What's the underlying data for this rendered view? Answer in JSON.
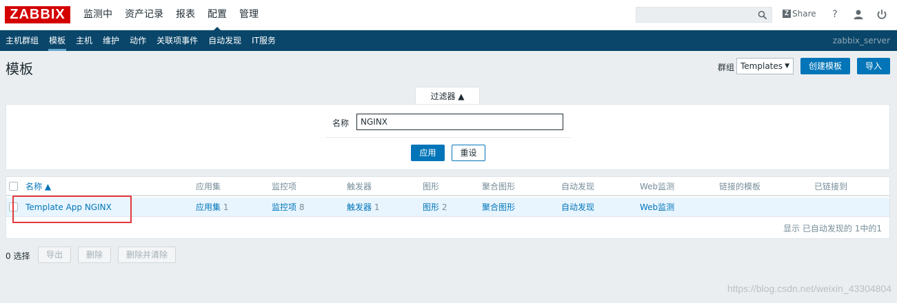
{
  "logo": "ZABBIX",
  "top_nav": [
    "监测中",
    "资产记录",
    "报表",
    "配置",
    "管理"
  ],
  "search": {
    "value": ""
  },
  "share_label": "Share",
  "help_icon": "?",
  "sub_nav": [
    "主机群组",
    "模板",
    "主机",
    "维护",
    "动作",
    "关联项事件",
    "自动发现",
    "IT服务"
  ],
  "server_name": "zabbix_server",
  "page_title": "模板",
  "group_filter": {
    "label": "群组",
    "value": "Templates"
  },
  "buttons": {
    "create": "创建模板",
    "import": "导入"
  },
  "filter": {
    "tab_label": "过滤器 ▲",
    "name_label": "名称",
    "name_value": "NGINX",
    "apply": "应用",
    "reset": "重设"
  },
  "table": {
    "headers": [
      "名称 ▲",
      "应用集",
      "监控项",
      "触发器",
      "图形",
      "聚合图形",
      "自动发现",
      "Web监测",
      "链接的模板",
      "已链接到"
    ],
    "rows": [
      {
        "name": "Template App NGINX",
        "applications": "应用集",
        "applications_count": "1",
        "items": "监控项",
        "items_count": "8",
        "triggers": "触发器",
        "triggers_count": "1",
        "graphs": "图形",
        "graphs_count": "2",
        "screens": "聚合图形",
        "discovery": "自动发现",
        "web": "Web监测"
      }
    ],
    "footer": "显示 已自动发现的 1中的1"
  },
  "actions": {
    "selected": "0 选择",
    "export": "导出",
    "delete": "删除",
    "delete_clear": "删除并清除"
  },
  "watermark": "https://blog.csdn.net/weixin_43304804",
  "colors": {
    "brand": "#d40000",
    "subnav": "#0a466a",
    "primary": "#0275b8",
    "highlight": "#e2383c"
  }
}
